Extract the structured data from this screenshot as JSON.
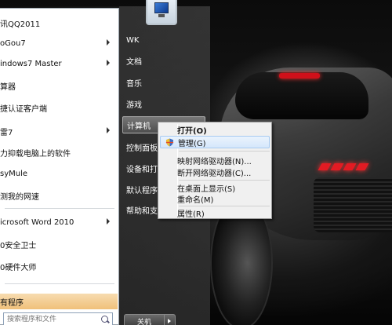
{
  "start_menu": {
    "programs": [
      {
        "label": "讯QQ2011",
        "has_submenu": false
      },
      {
        "label": "oGou7",
        "has_submenu": true
      },
      {
        "label": "indows7 Master",
        "has_submenu": true
      },
      {
        "label": "算器",
        "has_submenu": false
      },
      {
        "label": "捷认证客户端",
        "has_submenu": false
      },
      {
        "label": "雷7",
        "has_submenu": true
      },
      {
        "label": "力抑载电脑上的软件",
        "has_submenu": false
      },
      {
        "label": "syMule",
        "has_submenu": false
      },
      {
        "label": "测我的网速",
        "has_submenu": false
      },
      {
        "label": "icrosoft Word 2010",
        "has_submenu": true
      },
      {
        "label": "0安全卫士",
        "has_submenu": false
      },
      {
        "label": "0硬件大师",
        "has_submenu": false
      }
    ],
    "all_programs_label": "有程序",
    "search_placeholder": "搜索程序和文件",
    "right_items": [
      {
        "label": "WK"
      },
      {
        "label": "文档"
      },
      {
        "label": "音乐"
      },
      {
        "label": "游戏"
      },
      {
        "label": "计算机"
      },
      {
        "label": "控制面板"
      },
      {
        "label": "设备和打"
      },
      {
        "label": "默认程序"
      },
      {
        "label": "帮助和支"
      }
    ],
    "shutdown_label": "关机"
  },
  "context_menu": {
    "items": [
      {
        "label": "打开(O)"
      },
      {
        "label": "管理(G)"
      },
      {
        "label": "映射网络驱动器(N)..."
      },
      {
        "label": "断开网络驱动器(C)..."
      },
      {
        "label": "在桌面上显示(S)"
      },
      {
        "label": "重命名(M)"
      },
      {
        "label": "属性(R)"
      }
    ]
  }
}
